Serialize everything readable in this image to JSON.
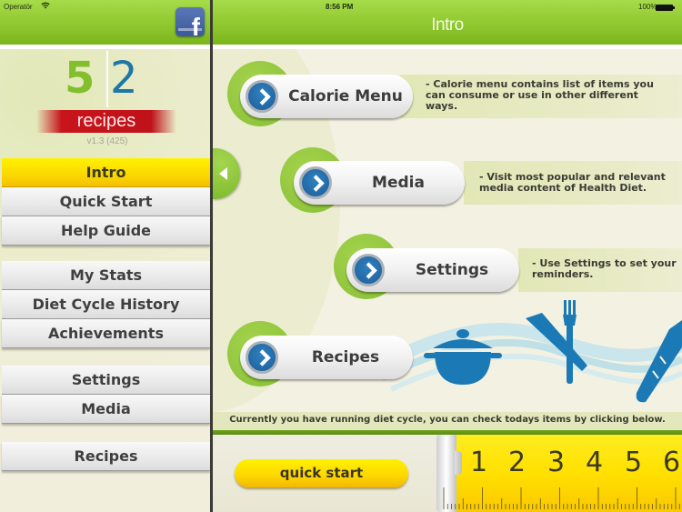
{
  "status_bar": {
    "carrier": "Operatör",
    "wifi_icon": "wifi-icon",
    "time": "8:56 PM",
    "battery": "100%",
    "battery_icon": "battery-full-icon"
  },
  "sidebar": {
    "facebook_icon": "facebook-icon",
    "logo": {
      "digit_left": "5",
      "digit_right": "2",
      "word": "recipes"
    },
    "version": "v1.3 (425)",
    "menu_groups": [
      [
        {
          "label": "Intro",
          "active": true
        },
        {
          "label": "Quick Start"
        },
        {
          "label": "Help Guide"
        }
      ],
      [
        {
          "label": "My Stats"
        },
        {
          "label": "Diet Cycle History"
        },
        {
          "label": "Achievements"
        }
      ],
      [
        {
          "label": "Settings"
        },
        {
          "label": "Media"
        }
      ],
      [
        {
          "label": "Recipes"
        }
      ]
    ]
  },
  "header": {
    "title": "Intro",
    "collapse_icon": "chevron-left-icon"
  },
  "features": [
    {
      "label": "Calorie Menu",
      "icon": "chevron-right-icon",
      "description": "- Calorie menu contains list of items you can consume or use in other different ways."
    },
    {
      "label": "Media",
      "icon": "chevron-right-icon",
      "description": "- Visit most popular and relevant media content of Health Diet."
    },
    {
      "label": "Settings",
      "icon": "chevron-right-icon",
      "description": "- Use Settings to set your reminders."
    },
    {
      "label": "Recipes",
      "icon": "chevron-right-icon",
      "description": ""
    }
  ],
  "decor_icons": [
    "cooking-pot-icon",
    "knife-fork-icon",
    "baguette-icon"
  ],
  "status_message": "Currently you have running diet cycle, you can check todays items by clicking below.",
  "footer": {
    "quick_start_label": "quick start",
    "tape_numbers": [
      "1",
      "2",
      "3",
      "4",
      "5",
      "6"
    ]
  },
  "colors": {
    "header_green": "#8fc82f",
    "active_yellow": "#fbd700",
    "arrow_blue": "#1d5d99",
    "logo_red": "#c8141a",
    "icon_blue": "#1b7ab5"
  }
}
